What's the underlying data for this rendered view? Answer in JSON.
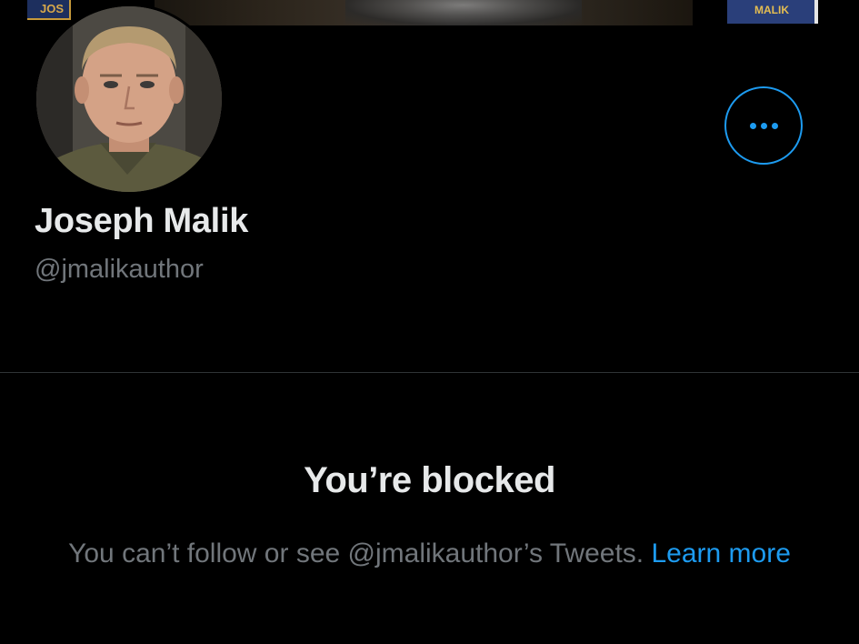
{
  "banner": {
    "book_left_text": "JOS",
    "book_right_text": "MALIK"
  },
  "profile": {
    "display_name": "Joseph Malik",
    "handle": "@jmalikauthor",
    "more_button_icon": "more-horizontal-icon"
  },
  "blocked": {
    "title": "You’re blocked",
    "message": "You can’t follow or see @jmalikauthor’s Tweets.",
    "link_label": "Learn more"
  },
  "colors": {
    "accent": "#1d9bf0",
    "background": "#000000",
    "primary_text": "#e7e9ea",
    "secondary_text": "#71767b",
    "divider": "#2f3336"
  }
}
